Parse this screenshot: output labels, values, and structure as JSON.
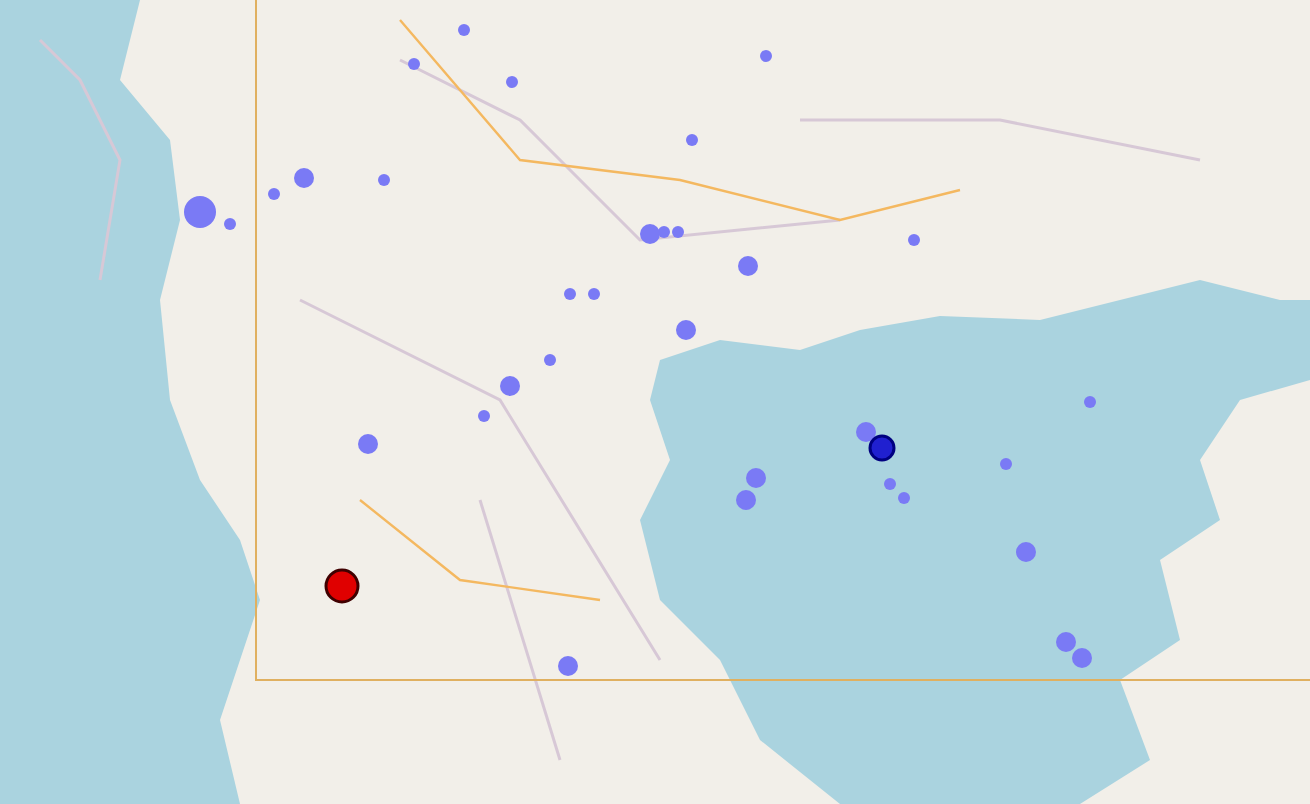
{
  "map": {
    "markers": [
      {
        "color": "#7a7af5",
        "kind": "small"
      },
      {
        "color": "#7a7af5",
        "kind": "small"
      },
      {
        "color": "#7a7af5",
        "kind": "small"
      },
      {
        "color": "#7a7af5",
        "kind": "small"
      },
      {
        "color": "#7a7af5",
        "kind": "small"
      },
      {
        "color": "#7a7af5",
        "kind": "medium"
      },
      {
        "color": "#7a7af5",
        "kind": "small"
      },
      {
        "color": "#7a7af5",
        "kind": "large"
      },
      {
        "color": "#7a7af5",
        "kind": "small"
      },
      {
        "color": "#7a7af5",
        "kind": "small"
      },
      {
        "color": "#7a7af5",
        "kind": "medium"
      },
      {
        "color": "#7a7af5",
        "kind": "small"
      },
      {
        "color": "#7a7af5",
        "kind": "small"
      },
      {
        "color": "#7a7af5",
        "kind": "medium"
      },
      {
        "color": "#7a7af5",
        "kind": "small"
      },
      {
        "color": "#7a7af5",
        "kind": "small"
      },
      {
        "color": "#7a7af5",
        "kind": "medium"
      },
      {
        "color": "#7a7af5",
        "kind": "small"
      },
      {
        "color": "#7a7af5",
        "kind": "small"
      },
      {
        "color": "#7a7af5",
        "kind": "medium"
      },
      {
        "color": "#7a7af5",
        "kind": "small"
      },
      {
        "color": "#7a7af5",
        "kind": "medium"
      },
      {
        "color": "#7a7af5",
        "kind": "medium"
      },
      {
        "color": "#7a7af5",
        "kind": "medium"
      },
      {
        "color": "#7a7af5",
        "kind": "medium"
      },
      {
        "color": "#2020d0",
        "kind": "ring"
      },
      {
        "color": "#7a7af5",
        "kind": "small"
      },
      {
        "color": "#7a7af5",
        "kind": "small"
      },
      {
        "color": "#7a7af5",
        "kind": "small"
      },
      {
        "color": "#7a7af5",
        "kind": "small"
      },
      {
        "color": "#7a7af5",
        "kind": "medium"
      },
      {
        "color": "#7a7af5",
        "kind": "medium"
      },
      {
        "color": "#7a7af5",
        "kind": "medium"
      },
      {
        "color": "#7a7af5",
        "kind": "medium"
      },
      {
        "color": "#e00000",
        "kind": "highlight"
      }
    ]
  }
}
